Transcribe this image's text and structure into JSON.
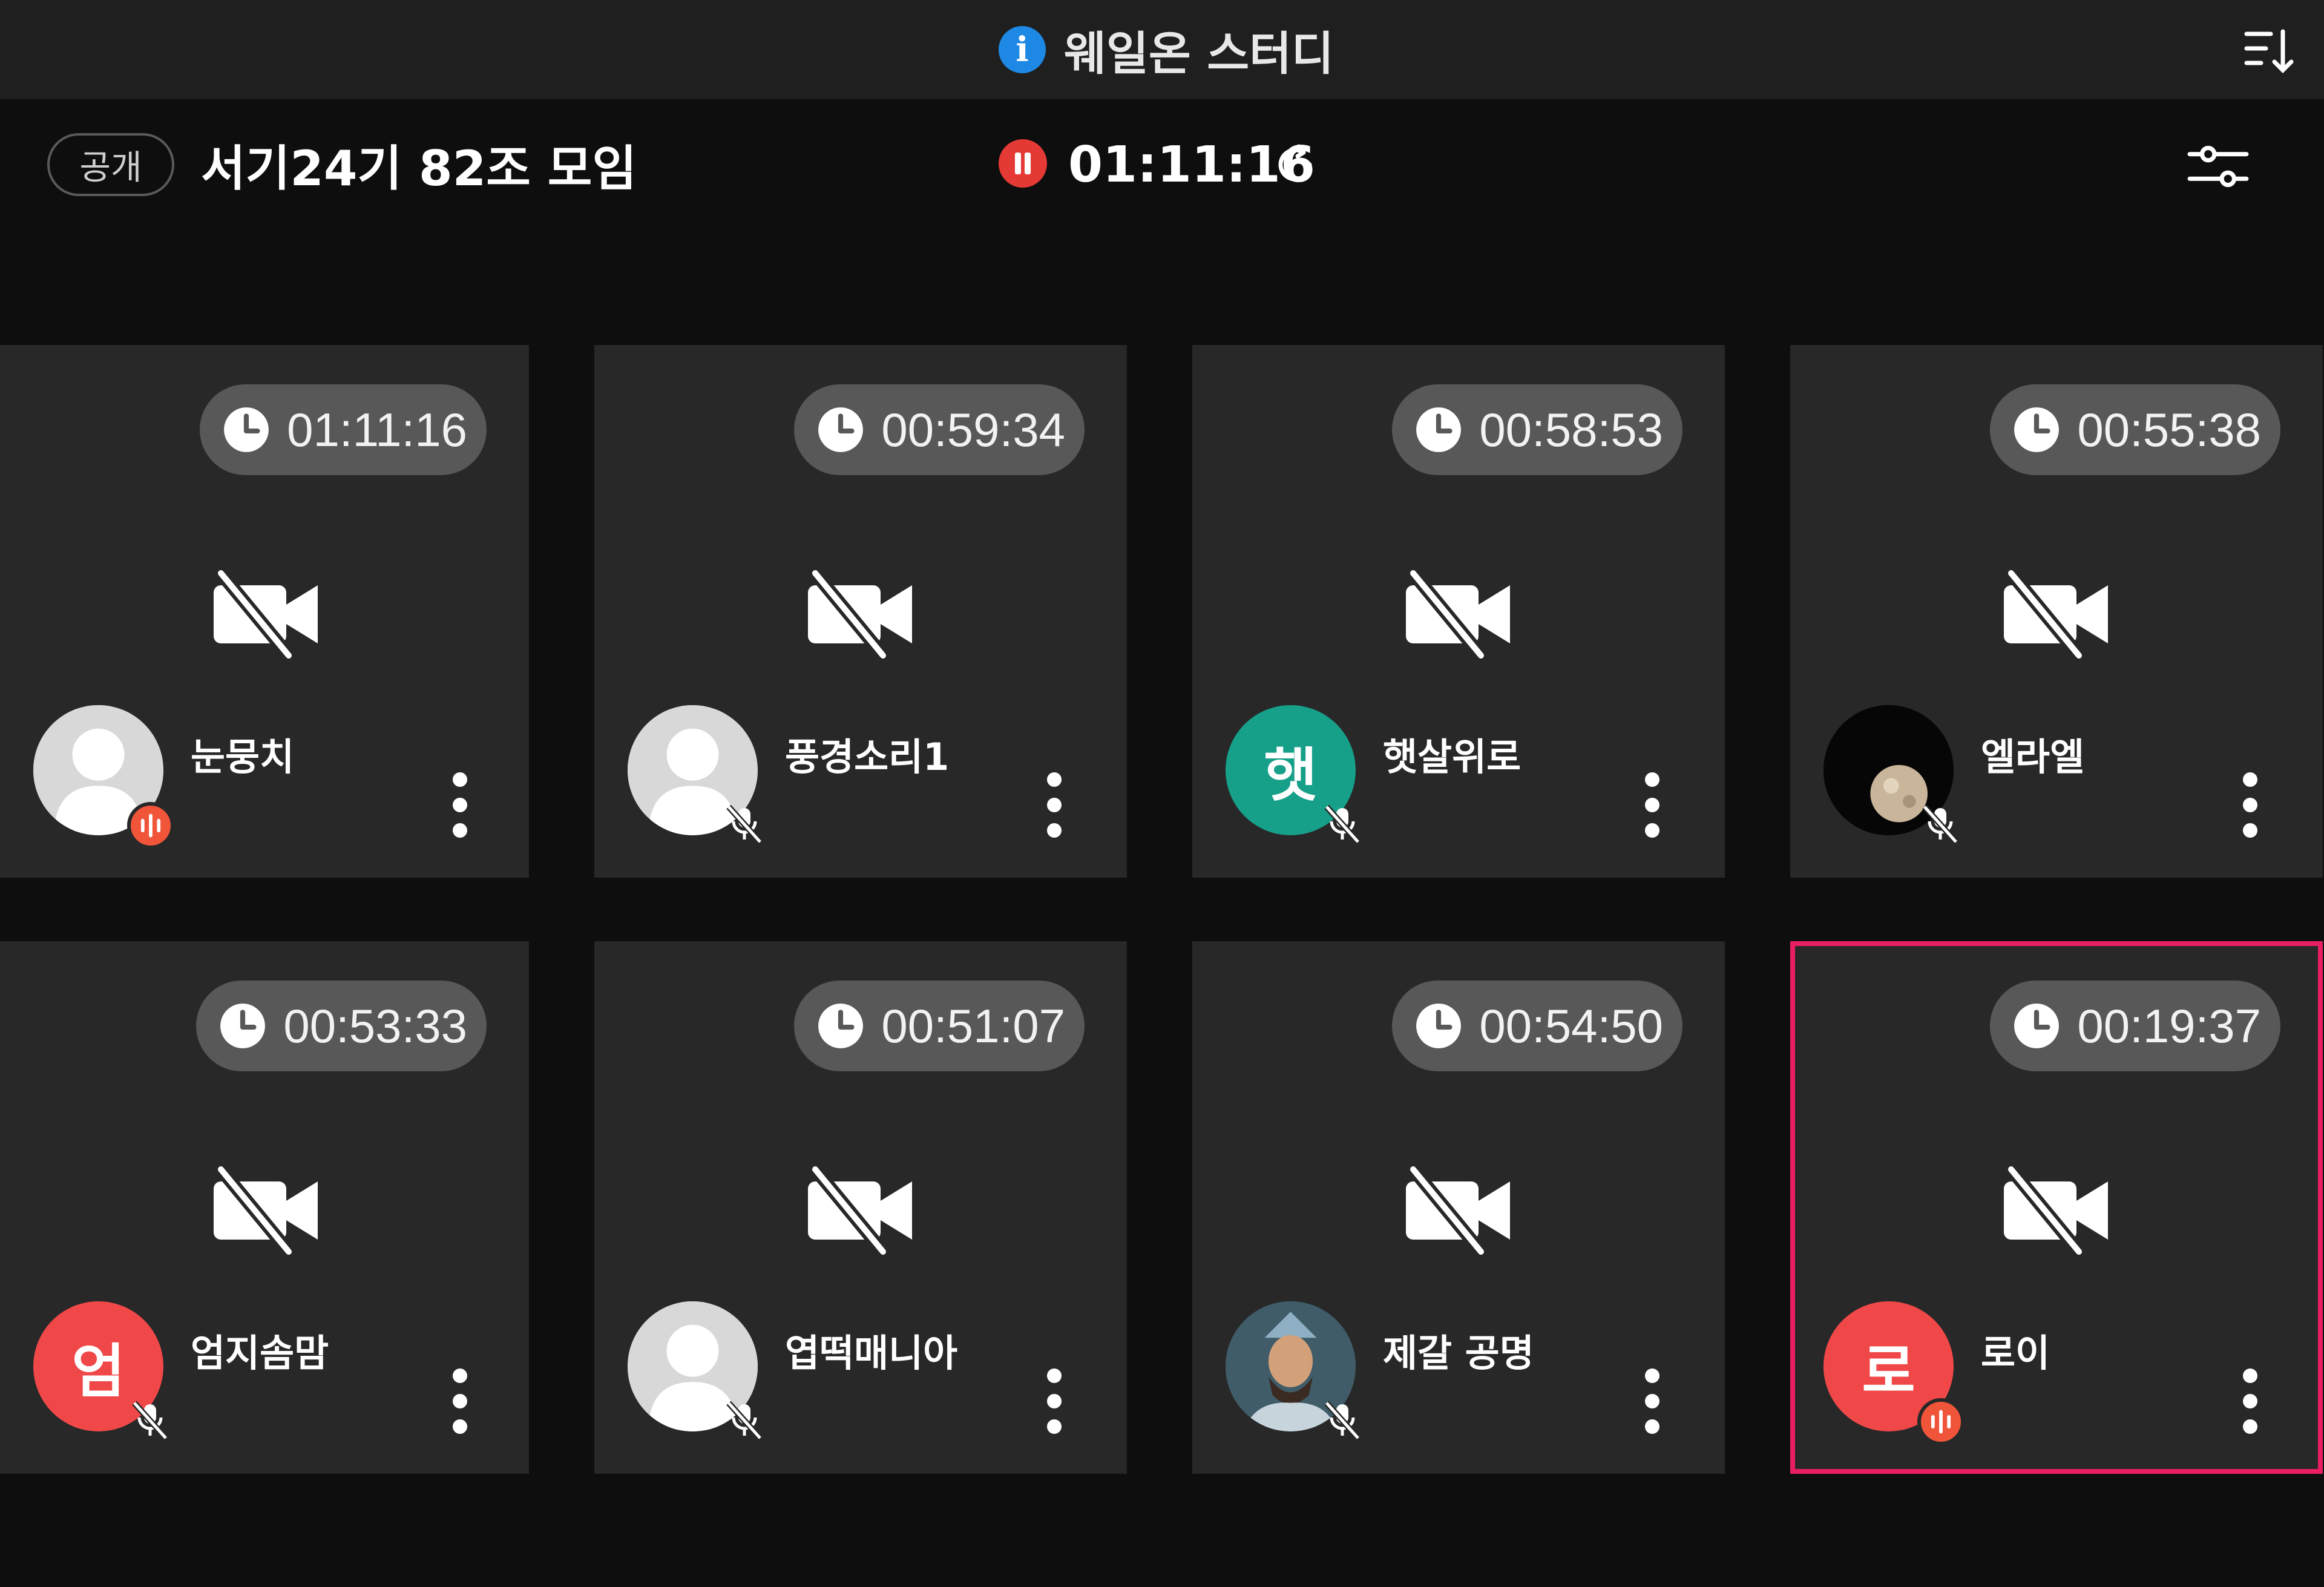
{
  "app": {
    "title": "웨일온 스터디"
  },
  "header": {
    "visibility_badge": "공개",
    "room_title": "서기24기 82조 모임",
    "timer": "01:11:16",
    "timer_state": "paused"
  },
  "colors": {
    "background": "#0e0e0e",
    "topbar": "#1f1f1f",
    "tile": "#282828",
    "pill": "#585858",
    "info_blue": "#1e88e5",
    "pause_red": "#e53935",
    "active_border": "#e91e63",
    "speaking_badge": "#f0553a"
  },
  "participants": [
    {
      "name": "눈뭉치",
      "time": "01:11:16",
      "avatar": "default-person",
      "status": "speaking",
      "camera": "off"
    },
    {
      "name": "풍경소리1",
      "time": "00:59:34",
      "avatar": "default-person",
      "status": "muted",
      "camera": "off"
    },
    {
      "name": "햇살위로",
      "time": "00:58:53",
      "avatar": "initial",
      "initial": "햇",
      "status": "muted",
      "camera": "off"
    },
    {
      "name": "엘라엘",
      "time": "00:55:38",
      "avatar": "planet-photo",
      "status": "muted",
      "camera": "off"
    },
    {
      "name": "엄지솜맘",
      "time": "00:53:33",
      "avatar": "initial",
      "initial": "엄",
      "status": "muted",
      "camera": "off"
    },
    {
      "name": "엽떡매니아",
      "time": "00:51:07",
      "avatar": "default-person",
      "status": "muted",
      "camera": "off"
    },
    {
      "name": "제갈 공명",
      "time": "00:54:50",
      "avatar": "portrait-photo",
      "status": "muted",
      "camera": "off"
    },
    {
      "name": "로이",
      "time": "00:19:37",
      "avatar": "initial",
      "initial": "로",
      "status": "speaking",
      "camera": "off",
      "active": true
    }
  ],
  "icons": {
    "info": "info-icon",
    "sort": "sort-icon",
    "pause": "pause-icon",
    "refresh": "refresh-icon",
    "settings": "settings-sliders-icon",
    "clock": "clock-icon",
    "camera_off": "camera-off-icon",
    "mic_muted": "mic-muted-icon",
    "speaking": "speaking-wave-icon",
    "more": "more-vertical-icon"
  }
}
